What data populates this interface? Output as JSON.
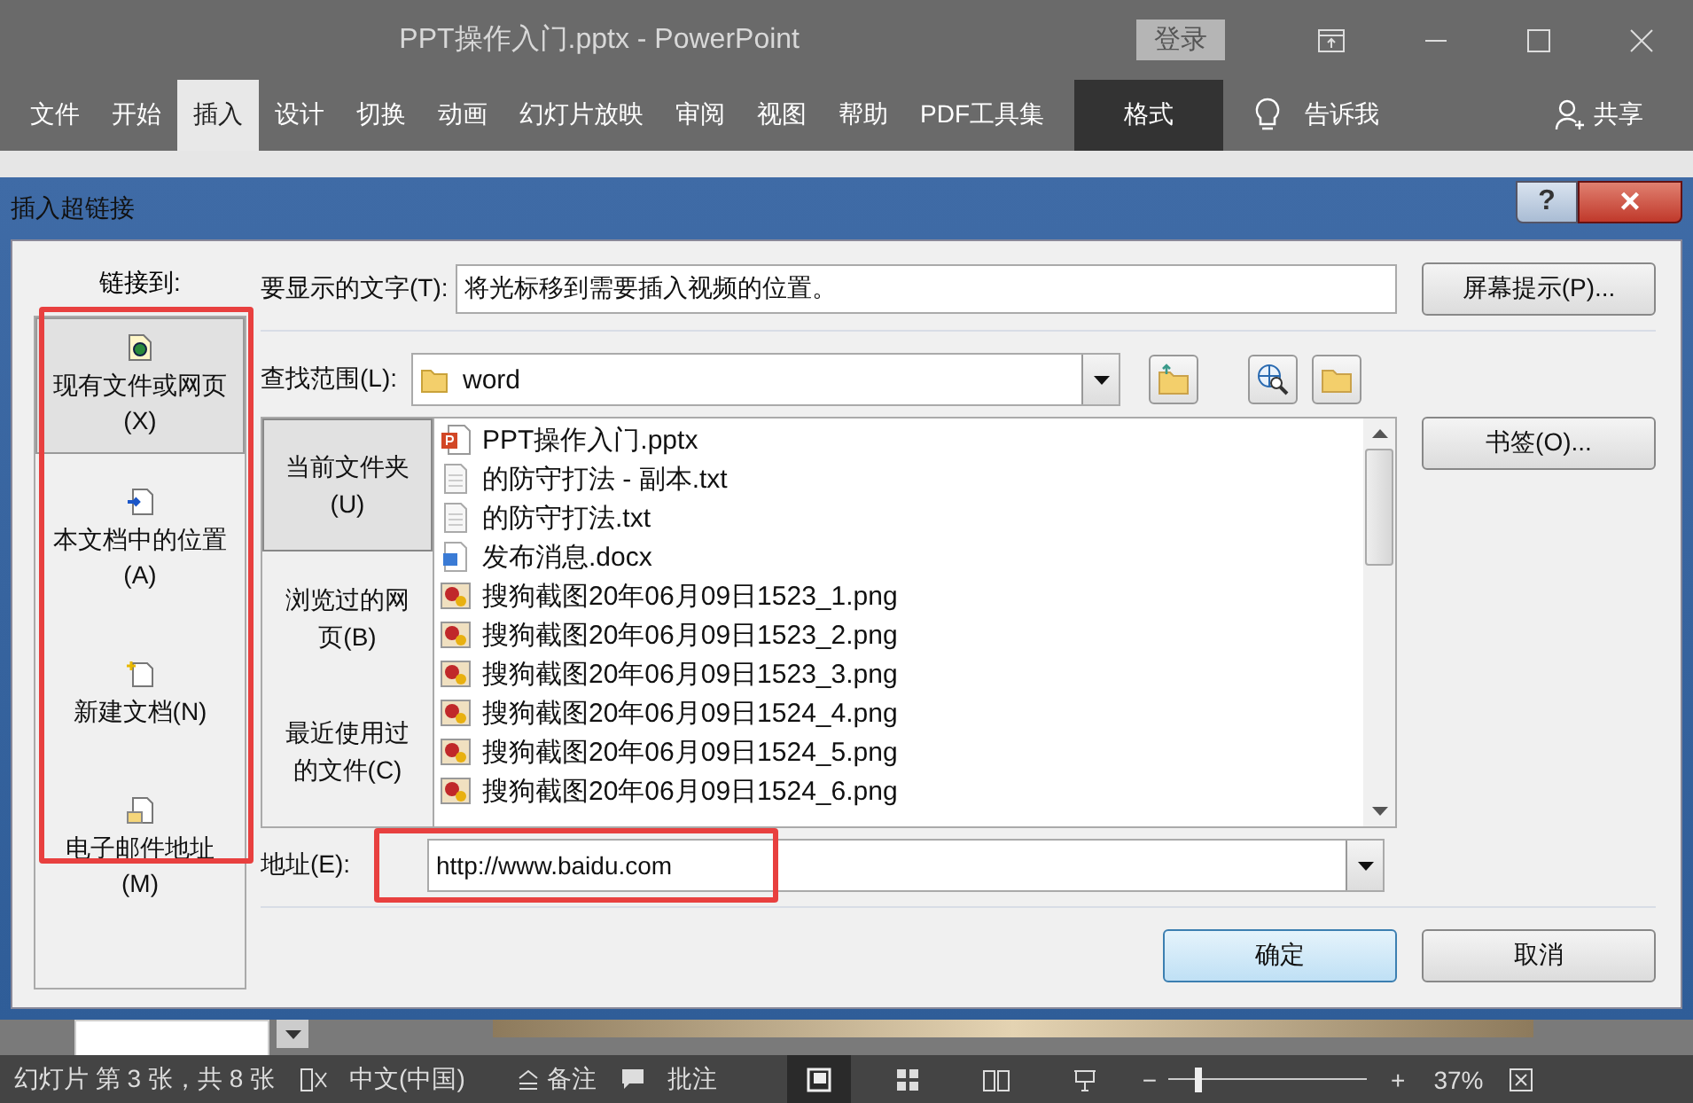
{
  "app": {
    "title": "PPT操作入门.pptx  -  PowerPoint",
    "login": "登录"
  },
  "ribbon_tabs": [
    {
      "label": "文件",
      "selected": false,
      "kind": "tab"
    },
    {
      "label": "开始",
      "selected": false,
      "kind": "tab"
    },
    {
      "label": "插入",
      "selected": true,
      "kind": "tab"
    },
    {
      "label": "设计",
      "selected": false,
      "kind": "tab"
    },
    {
      "label": "切换",
      "selected": false,
      "kind": "tab"
    },
    {
      "label": "动画",
      "selected": false,
      "kind": "tab"
    },
    {
      "label": "幻灯片放映",
      "selected": false,
      "kind": "tab"
    },
    {
      "label": "审阅",
      "selected": false,
      "kind": "tab"
    },
    {
      "label": "视图",
      "selected": false,
      "kind": "tab"
    },
    {
      "label": "帮助",
      "selected": false,
      "kind": "tab"
    },
    {
      "label": "PDF工具集",
      "selected": false,
      "kind": "tab"
    },
    {
      "label": "格式",
      "selected": false,
      "kind": "context"
    }
  ],
  "tell_me": "告诉我",
  "share": "共享",
  "dialog": {
    "title": "插入超链接",
    "help": "?",
    "close": "×",
    "link_to_label": "链接到:",
    "link_to": [
      {
        "label": "现有文件或网页\n(X)",
        "selected": true,
        "kind": "file"
      },
      {
        "label": "本文档中的位置\n(A)",
        "selected": false,
        "kind": "place"
      },
      {
        "label": "新建文档(N)",
        "selected": false,
        "kind": "new"
      },
      {
        "label": "电子邮件地址\n(M)",
        "selected": false,
        "kind": "email"
      }
    ],
    "display_text_label": "要显示的文字(T):",
    "display_text": "将光标移到需要插入视频的位置。",
    "screentip_button": "屏幕提示(P)...",
    "look_in_label": "查找范围(L):",
    "look_in": "word",
    "bookmark_button": "书签(O)...",
    "nav": [
      {
        "label": "当前文件夹\n(U)",
        "selected": true
      },
      {
        "label": "浏览过的网页(B)",
        "selected": false
      },
      {
        "label": "最近使用过的文件(C)",
        "selected": false
      }
    ],
    "files": [
      {
        "name": "PPT操作入门.pptx",
        "kind": "pptx"
      },
      {
        "name": "的防守打法 - 副本.txt",
        "kind": "txt"
      },
      {
        "name": "的防守打法.txt",
        "kind": "txt"
      },
      {
        "name": "发布消息.docx",
        "kind": "docx"
      },
      {
        "name": "搜狗截图20年06月09日1523_1.png",
        "kind": "png"
      },
      {
        "name": "搜狗截图20年06月09日1523_2.png",
        "kind": "png"
      },
      {
        "name": "搜狗截图20年06月09日1523_3.png",
        "kind": "png"
      },
      {
        "name": "搜狗截图20年06月09日1524_4.png",
        "kind": "png"
      },
      {
        "name": "搜狗截图20年06月09日1524_5.png",
        "kind": "png"
      },
      {
        "name": "搜狗截图20年06月09日1524_6.png",
        "kind": "png"
      }
    ],
    "address_label": "地址(E):",
    "address": "http://www.baidu.com",
    "ok": "确定",
    "cancel": "取消"
  },
  "status": {
    "slide": "幻灯片 第 3 张，共 8 张",
    "language": "中文(中国)",
    "notes": "备注",
    "comments": "批注",
    "minus": "−",
    "plus": "+",
    "zoom_slider": {
      "level": 0.16
    },
    "zoom": "37%"
  }
}
